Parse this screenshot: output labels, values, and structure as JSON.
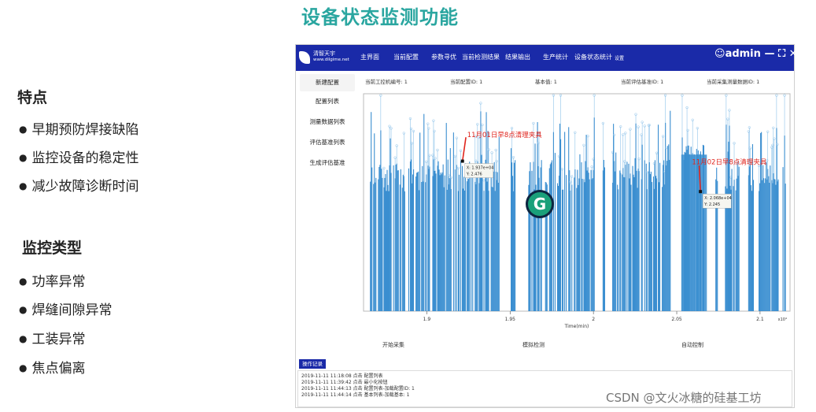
{
  "page_title": "设备状态监测功能",
  "features": {
    "heading": "特点",
    "items": [
      "早期预防焊接缺陷",
      "监控设备的稳定性",
      "减少故障诊断时间"
    ]
  },
  "monitor_types": {
    "heading": "监控类型",
    "items": [
      "功率异常",
      "焊缝间隙异常",
      "工装异常",
      "焦点偏离"
    ]
  },
  "app": {
    "logo_line1": "清智天宇",
    "logo_line2": "www.dilgime.net",
    "nav": [
      "主界面",
      "当前配置",
      "参数寻优",
      "当前检测结果",
      "结果输出",
      "生产统计",
      "设备状态统计"
    ],
    "nav_small": "设置",
    "user": "admin",
    "window_controls": "— ⛶ ✕",
    "sidebar": [
      "新建配置",
      "配置列表",
      "测量数据列表",
      "评估基准列表",
      "生成评估基准"
    ],
    "info": [
      "当前工控机编号: 1",
      "当前配置ID: 1",
      "基本值: 1",
      "当前评估基准ID: 1",
      "当前采集测量数据ID: 1"
    ],
    "controls": [
      "开始采集",
      "模拟检测",
      "自动控制"
    ],
    "log_tab": "操作记录",
    "log_lines": [
      "2019-11-11 11:18:08  点击 配置列表",
      "2019-11-11 11:39:42  点击 最小化按钮",
      "2019-11-11 11:44:13  点击 配置列表-加载配置ID: 1",
      "2019-11-11 11:44:14  点击 基本列表-加载基本: 1"
    ]
  },
  "chart_data": {
    "type": "bar",
    "xlabel": "Time(min)",
    "x_ticks": [
      "1.9",
      "1.95",
      "2",
      "2.05",
      "2.1"
    ],
    "x_exponent": "x10⁴",
    "xlim": [
      1.862,
      2.118
    ],
    "annotations": [
      {
        "label": "11月01日早8点清理夹具",
        "point_text": [
          "X: 1.937e+04",
          "Y: 2.476"
        ]
      },
      {
        "label": "11月02日早8点清理夹具",
        "point_text": [
          "X: 2.068e+04",
          "Y: 2.245"
        ]
      }
    ],
    "series_color": "#3a8ed0"
  },
  "watermark": "CSDN @文火冰糖的硅基工坊"
}
